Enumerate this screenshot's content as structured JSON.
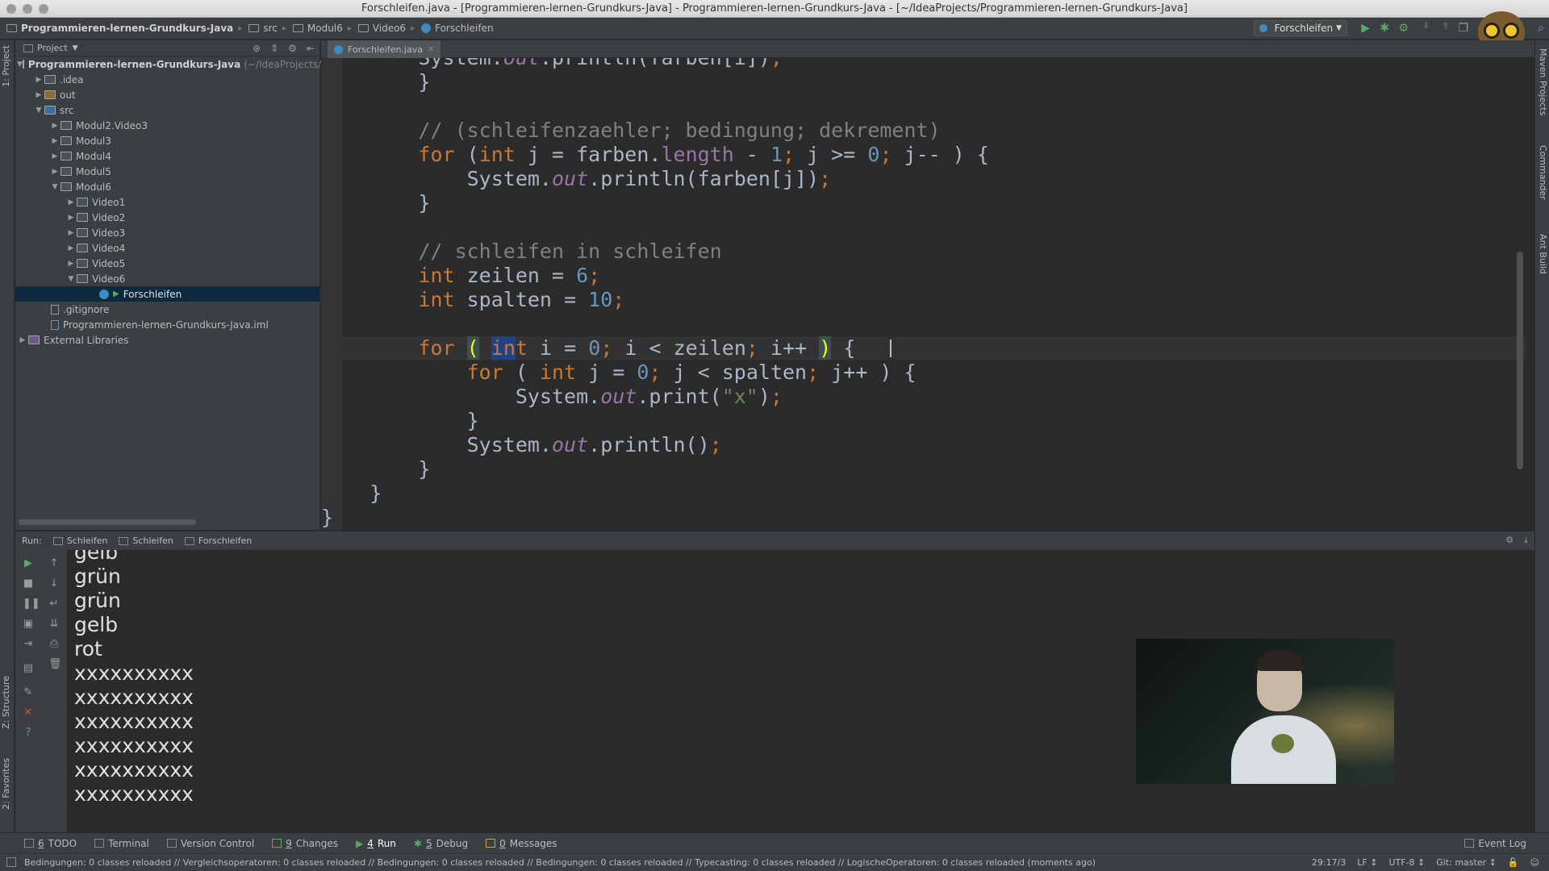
{
  "window": {
    "title": "Forschleifen.java - [Programmieren-lernen-Grundkurs-Java] - Programmieren-lernen-Grundkurs-Java - [~/IdeaProjects/Programmieren-lernen-Grundkurs-Java]"
  },
  "navbar": {
    "crumbs": [
      "Programmieren-lernen-Grundkurs-Java",
      "src",
      "Modul6",
      "Video6",
      "Forschleifen"
    ],
    "run_config": "Forschleifen"
  },
  "left_strip": {
    "project_tab": "1: Project",
    "structure_tab": "Z: Structure",
    "favorites_tab": "2: Favorites"
  },
  "right_strip": {
    "maven_tab": "Maven Projects",
    "commander_tab": "Commander",
    "ant_tab": "Ant Build"
  },
  "project_panel": {
    "title": "Project",
    "tree": [
      {
        "label": "Programmieren-lernen-Grundkurs-Java",
        "suffix": "(~/IdeaProjects/Programmieren-lernen-Grundkurs-Java)"
      },
      {
        "label": ".idea"
      },
      {
        "label": "out"
      },
      {
        "label": "src"
      },
      {
        "label": "Modul2.Video3"
      },
      {
        "label": "Modul3"
      },
      {
        "label": "Modul4"
      },
      {
        "label": "Modul5"
      },
      {
        "label": "Modul6"
      },
      {
        "label": "Video1"
      },
      {
        "label": "Video2"
      },
      {
        "label": "Video3"
      },
      {
        "label": "Video4"
      },
      {
        "label": "Video5"
      },
      {
        "label": "Video6"
      },
      {
        "label": "Forschleifen"
      },
      {
        "label": ".gitignore"
      },
      {
        "label": "Programmieren-lernen-Grundkurs-Java.iml"
      },
      {
        "label": "External Libraries"
      }
    ]
  },
  "editor": {
    "tab_label": "Forschleifen.java"
  },
  "run_panel": {
    "label": "Run:",
    "tabs": [
      "Schleifen",
      "Schleifen",
      "Forschleifen"
    ],
    "console_lines": [
      "gelb",
      "grün",
      "grün",
      "gelb",
      "rot",
      "xxxxxxxxxx",
      "xxxxxxxxxx",
      "xxxxxxxxxx",
      "xxxxxxxxxx",
      "xxxxxxxxxx",
      "xxxxxxxxxx"
    ]
  },
  "bottom_toolbar": {
    "buttons": [
      {
        "num": "6",
        "label": "TODO"
      },
      {
        "num": "",
        "label": "Terminal"
      },
      {
        "num": "",
        "label": "Version Control"
      },
      {
        "num": "9",
        "label": "Changes"
      },
      {
        "num": "4",
        "label": "Run"
      },
      {
        "num": "5",
        "label": "Debug"
      },
      {
        "num": "0",
        "label": "Messages"
      }
    ],
    "event_log": "Event Log"
  },
  "status_bar": {
    "message": "Bedingungen: 0 classes reloaded // Vergleichsoperatoren: 0 classes reloaded // Bedingungen: 0 classes reloaded // Bedingungen: 0 classes reloaded // Typecasting: 0 classes reloaded // LogischeOperatoren: 0 classes reloaded (moments ago)",
    "position": "29:17/3",
    "line_sep": "LF ↕",
    "encoding": "UTF-8 ↕",
    "git": "Git: master ↕"
  },
  "colors": {
    "editor_bg": "#2b2b2b",
    "panel_bg": "#3c3f41",
    "keyword": "#cc7832",
    "number": "#6897bb",
    "comment": "#808080",
    "string": "#6a8759",
    "field": "#9876aa",
    "selection": "#214283",
    "tree_selection": "#0d293e"
  },
  "icons": [
    "folder-icon",
    "java-class-icon",
    "run-icon",
    "debug-icon",
    "stop-icon",
    "pause-icon",
    "gear-icon",
    "owl-logo"
  ]
}
